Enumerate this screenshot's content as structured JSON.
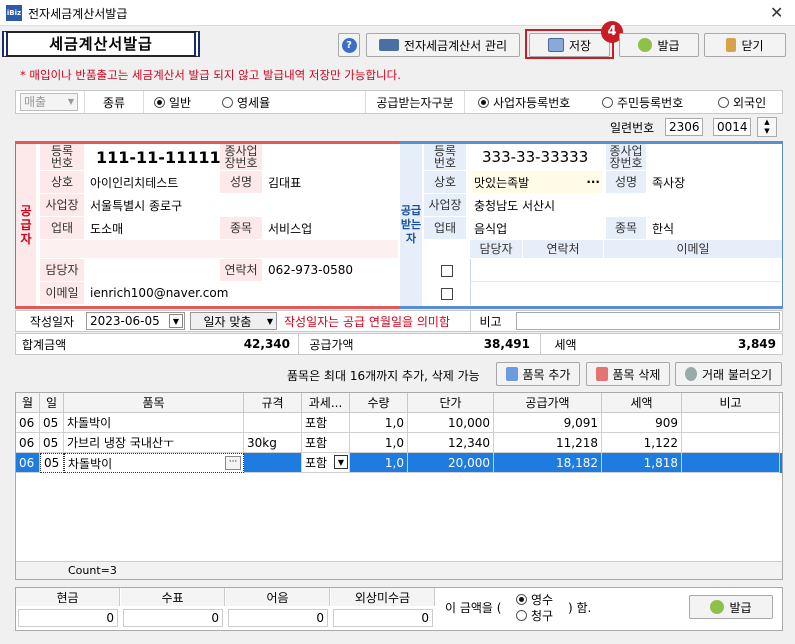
{
  "window": {
    "icon_text": "iBiz",
    "title": "전자세금계산서발급",
    "close": "✕"
  },
  "header": {
    "title": "세금계산서발급"
  },
  "toolbar": {
    "help": "?",
    "manage": "전자세금계산서 관리",
    "save": "저장",
    "issue": "발급",
    "close": "닫기",
    "badge": "4"
  },
  "notice": "* 매입이나 반품출고는 세금계산서 발급 되지 않고 발급내역 저장만 가능합니다.",
  "type_row": {
    "trade_select": "매출",
    "kind_label": "종류",
    "kind_general": "일반",
    "kind_zero": "영세율",
    "recv_label": "공급받는자구분",
    "recv_biz": "사업자등록번호",
    "recv_resident": "주민등록번호",
    "recv_foreign": "외국인"
  },
  "serial": {
    "label": "일련번호",
    "part1": "2306",
    "part2": "0014",
    "up": "▲",
    "down": "▼"
  },
  "supplier": {
    "side_label": "공급자",
    "reg_label": "등록\n번호",
    "reg_no": "111-11-11111",
    "sub_label": "종사업\n장번호",
    "name_label": "상호",
    "name": "아이인리치테스트",
    "ceo_label": "성명",
    "ceo": "김대표",
    "addr_label": "사업장",
    "addr": "서울특별시 종로구",
    "type_label": "업태",
    "type": "도소매",
    "item_label": "종목",
    "item": "서비스업",
    "manager_label": "담당자",
    "phone_label": "연락처",
    "phone": "062-973-0580",
    "email_label": "이메일",
    "email": "ienrich100@naver.com"
  },
  "receiver": {
    "side_label": "공급받는자",
    "reg_label": "등록\n번호",
    "reg_no": "333-33-33333",
    "sub_label": "종사업\n장번호",
    "name_label": "상호",
    "name": "맛있는족발",
    "dots": "···",
    "ceo_label": "성명",
    "ceo": "족사장",
    "addr_label": "사업장",
    "addr": "충청남도 서산시",
    "type_label": "업태",
    "type": "음식업",
    "item_label": "종목",
    "item": "한식",
    "manager_label": "담당자",
    "phone_label": "연락처",
    "email_label": "이메일"
  },
  "date_row": {
    "label": "작성일자",
    "date": "2023-06-05",
    "fit": "일자 맞춤",
    "hint": "작성일자는 공급 연월일을 의미함",
    "note_label": "비고"
  },
  "sum_row": {
    "total_label": "합계금액",
    "total": "42,340",
    "supply_label": "공급가액",
    "supply": "38,491",
    "tax_label": "세액",
    "tax": "3,849"
  },
  "items_bar": {
    "hint": "품목은 최대 16개까지 추가, 삭제 가능",
    "add": "품목 추가",
    "delete": "품목 삭제",
    "load": "거래 불러오기"
  },
  "grid": {
    "headers": [
      "월",
      "일",
      "품목",
      "규격",
      "과세...",
      "수량",
      "단가",
      "공급가액",
      "세액",
      "비고"
    ],
    "rows": [
      [
        "06",
        "05",
        "차돌박이",
        "",
        "포함",
        "1,0",
        "10,000",
        "9,091",
        "909",
        ""
      ],
      [
        "06",
        "05",
        "가브리 냉장 국내산ㅜ",
        "30kg",
        "포함",
        "1,0",
        "12,340",
        "11,218",
        "1,122",
        ""
      ],
      [
        "06",
        "05",
        "차돌박이",
        "",
        "포함",
        "1,0",
        "20,000",
        "18,182",
        "1,818",
        ""
      ]
    ],
    "count": "Count=3"
  },
  "payment": {
    "cash": "현금",
    "check": "수표",
    "note": "어음",
    "credit": "외상미수금",
    "cash_v": "0",
    "check_v": "0",
    "note_v": "0",
    "credit_v": "0",
    "prefix": "이 금액을 (",
    "receipt": "영수",
    "claim": "청구",
    "suffix": ") 함.",
    "issue": "발급"
  }
}
